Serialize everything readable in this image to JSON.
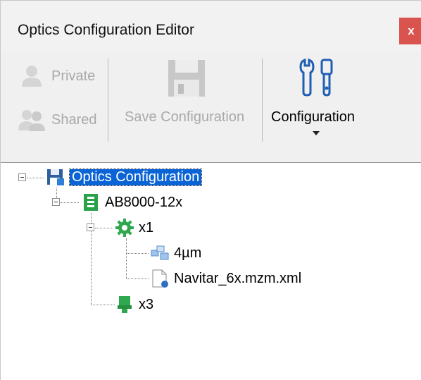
{
  "window": {
    "title": "Optics Configuration Editor",
    "close_label": "x"
  },
  "ribbon": {
    "private_label": "Private",
    "shared_label": "Shared",
    "save_label": "Save Configuration",
    "configuration_label": "Configuration"
  },
  "tree": {
    "root": "Optics Configuration",
    "device": "AB8000-12x",
    "objective": "x1",
    "pixel": "4µm",
    "file": "Navitar_6x.mzm.xml",
    "objective2": "x3"
  },
  "colors": {
    "accent": "#0a64d6",
    "close": "#d9534f",
    "icon_green": "#28a745"
  }
}
